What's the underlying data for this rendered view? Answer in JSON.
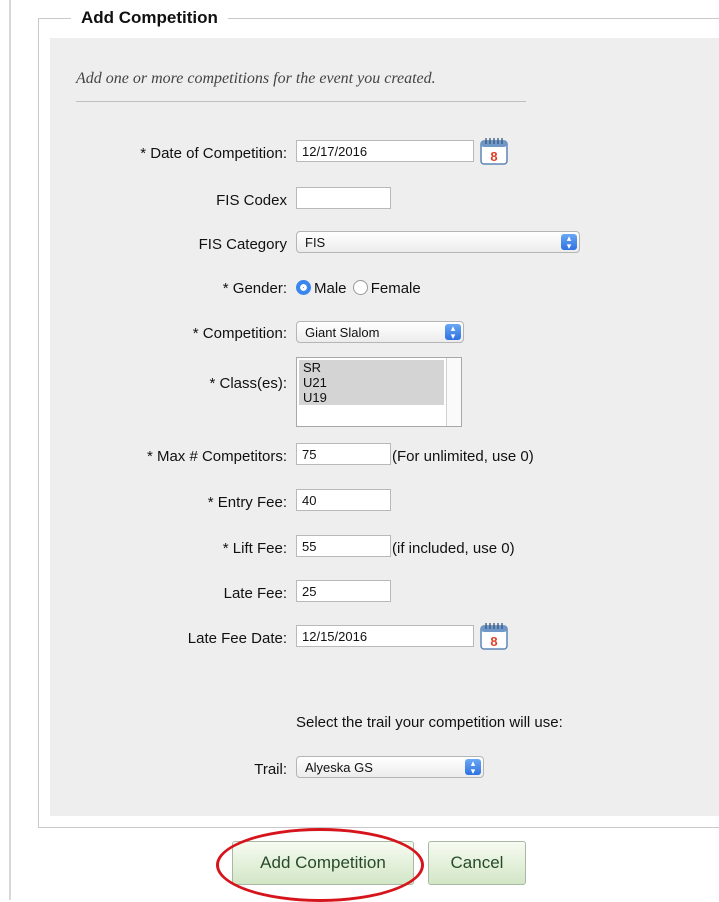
{
  "form": {
    "legend": "Add Competition",
    "intro": "Add one or more competitions for the event you created.",
    "fields": {
      "date_label": "* Date of Competition:",
      "date_value": "12/17/2016",
      "fis_codex_label": "FIS Codex",
      "fis_codex_value": "",
      "fis_category_label": "FIS Category",
      "fis_category_value": "FIS",
      "gender_label": "* Gender:",
      "gender_male": "Male",
      "gender_female": "Female",
      "competition_label": "* Competition:",
      "competition_value": "Giant Slalom",
      "classes_label": "* Class(es):",
      "classes_options": [
        "SR",
        "U21",
        "U19"
      ],
      "max_label": "* Max # Competitors:",
      "max_value": "75",
      "max_note": "(For unlimited, use 0)",
      "entry_fee_label": "* Entry Fee:",
      "entry_fee_value": "40",
      "lift_fee_label": "* Lift Fee:",
      "lift_fee_value": "55",
      "lift_fee_note": "(if included, use 0)",
      "late_fee_label": "Late Fee:",
      "late_fee_value": "25",
      "late_fee_date_label": "Late Fee Date:",
      "late_fee_date_value": "12/15/2016",
      "trail_prompt": "Select the trail your competition will use:",
      "trail_label": "Trail:",
      "trail_value": "Alyeska GS"
    },
    "calendar_day": "8"
  },
  "actions": {
    "add_label": "Add Competition",
    "cancel_label": "Cancel"
  },
  "colors": {
    "highlight_circle": "#d6141c",
    "radio_selected": "#3a85ee",
    "calendar_number": "#e0402a"
  }
}
